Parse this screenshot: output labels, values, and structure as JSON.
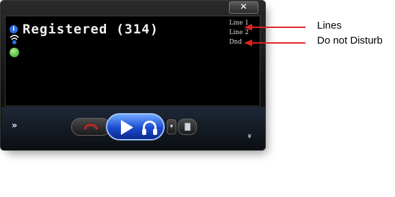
{
  "window": {
    "close_label": "✕",
    "status_text": "Registered (314)",
    "indicators": [
      "Line 1",
      "Line 2",
      "Dnd"
    ]
  },
  "controls": {
    "expand_left": "»",
    "expand_right": "»",
    "dropdown_label": "▾"
  },
  "annotations": {
    "lines": "Lines",
    "dnd": "Do not Disturb"
  },
  "colors": {
    "accent_blue": "#1b4bcf",
    "hangup_red": "#c42424",
    "annotation_arrow": "#e02020"
  }
}
